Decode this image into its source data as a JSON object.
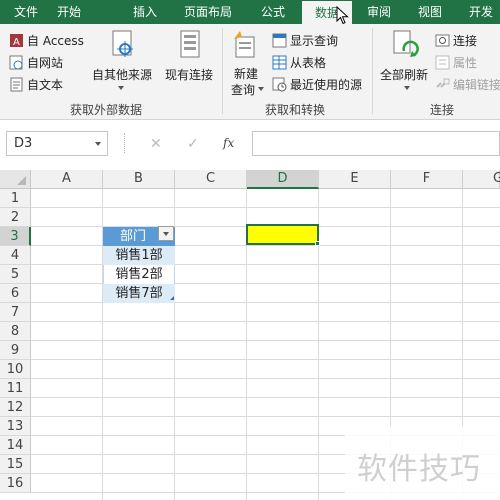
{
  "tabs": [
    "文件",
    "开始",
    "插入",
    "页面布局",
    "公式",
    "数据",
    "审阅",
    "视图",
    "开发"
  ],
  "active_tab": "数据",
  "ribbon": {
    "get_external": {
      "access": "自 Access",
      "web": "自网站",
      "text": "自文本",
      "other_sources": "自其他来源",
      "existing_connections": "现有连接",
      "group_label": "获取外部数据"
    },
    "get_transform": {
      "new_query_line1": "新建",
      "new_query_line2": "查询",
      "show_queries": "显示查询",
      "from_table": "从表格",
      "recent_sources": "最近使用的源",
      "group_label": "获取和转换"
    },
    "connections": {
      "refresh_all": "全部刷新",
      "connections": "连接",
      "properties": "属性",
      "edit_links": "编辑链接",
      "group_label": "连接"
    }
  },
  "formula_bar": {
    "name_box": "D3",
    "cancel_glyph": "✕",
    "enter_glyph": "✓",
    "fx_glyph": "fx",
    "formula": ""
  },
  "grid": {
    "columns": [
      "A",
      "B",
      "C",
      "D",
      "E",
      "F",
      "G"
    ],
    "selected_column": "D",
    "rows": [
      "1",
      "2",
      "3",
      "4",
      "5",
      "6",
      "7",
      "8",
      "9",
      "10",
      "11",
      "12",
      "13",
      "14",
      "15",
      "16"
    ],
    "selected_row": "3",
    "table": {
      "header": "部门",
      "values": [
        "销售1部",
        "销售2部",
        "销售7部"
      ]
    },
    "active_cell_fill": "#ffff00"
  },
  "colors": {
    "accent": "#217346",
    "table_header": "#5b9bd5",
    "table_band": "#ddebf7"
  },
  "watermark": "软件技巧"
}
